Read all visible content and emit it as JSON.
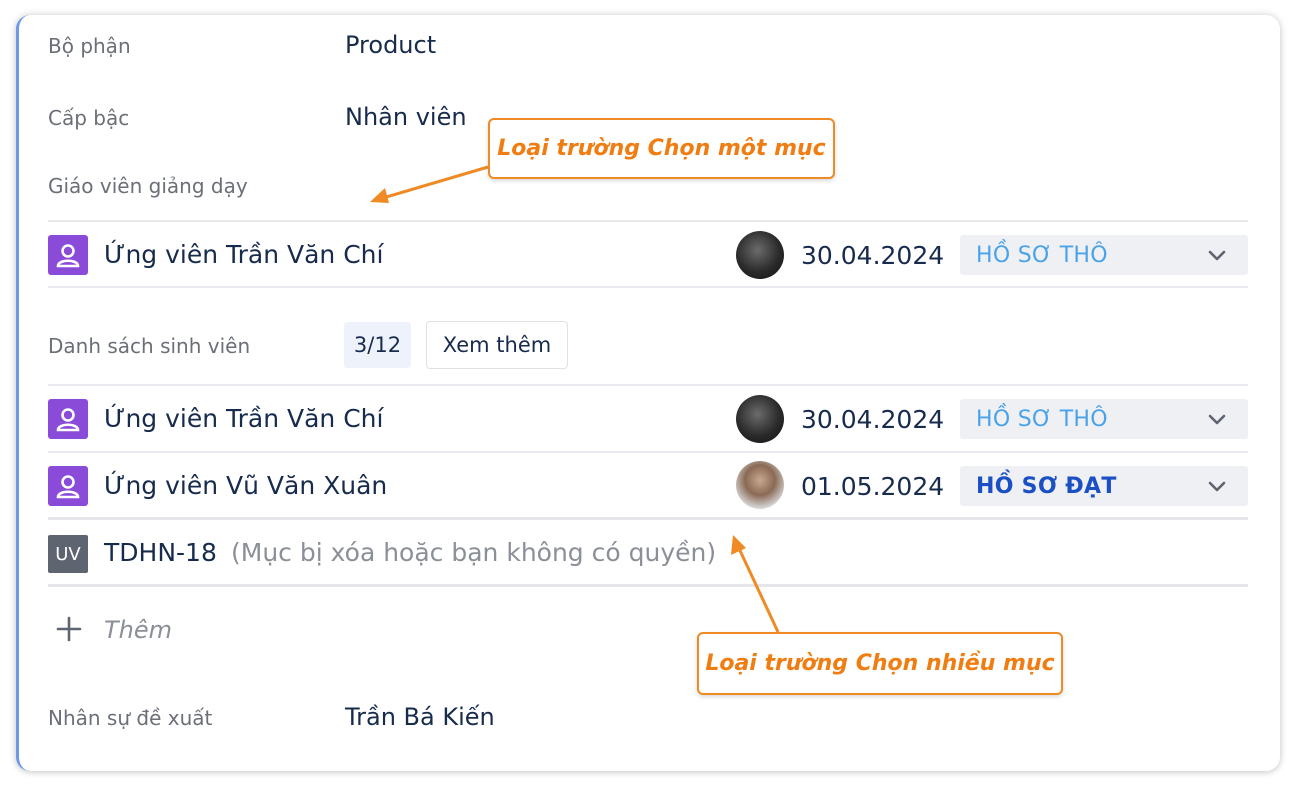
{
  "fields": {
    "department": {
      "label": "Bộ phận",
      "value": "Product"
    },
    "level": {
      "label": "Cấp bậc",
      "value": "Nhân viên"
    },
    "teacher": {
      "label": "Giáo viên giảng dạy"
    },
    "students": {
      "label": "Danh sách sinh viên",
      "count": "3/12",
      "more_button": "Xem thêm"
    },
    "proposer": {
      "label": "Nhân sự đề xuất",
      "value": "Trần Bá Kiến"
    }
  },
  "teacher_row": {
    "name": "Ứng viên Trần Văn Chí",
    "date": "30.04.2024",
    "status": "HỒ SƠ THÔ"
  },
  "student_rows": [
    {
      "name": "Ứng viên Trần Văn Chí",
      "date": "30.04.2024",
      "status": "HỒ SƠ THÔ"
    },
    {
      "name": "Ứng viên Vũ Văn Xuân",
      "date": "01.05.2024",
      "status": "HỒ SƠ ĐẠT"
    }
  ],
  "deleted_row": {
    "badge": "UV",
    "key": "TDHN-18",
    "note": "(Mục bị xóa hoặc bạn không có quyền)"
  },
  "add_label": "Thêm",
  "callouts": {
    "single": "Loại trường Chọn một mục",
    "multi": "Loại trường Chọn nhiều mục"
  },
  "colors": {
    "accent_orange": "#f08a24",
    "status_raw": "#4aa3e8",
    "status_pass": "#1b4fc4",
    "user_icon_bg": "#8b4bd9"
  },
  "icons": [
    "user-icon",
    "chevron-down-icon",
    "plus-icon",
    "arrow-icon"
  ]
}
